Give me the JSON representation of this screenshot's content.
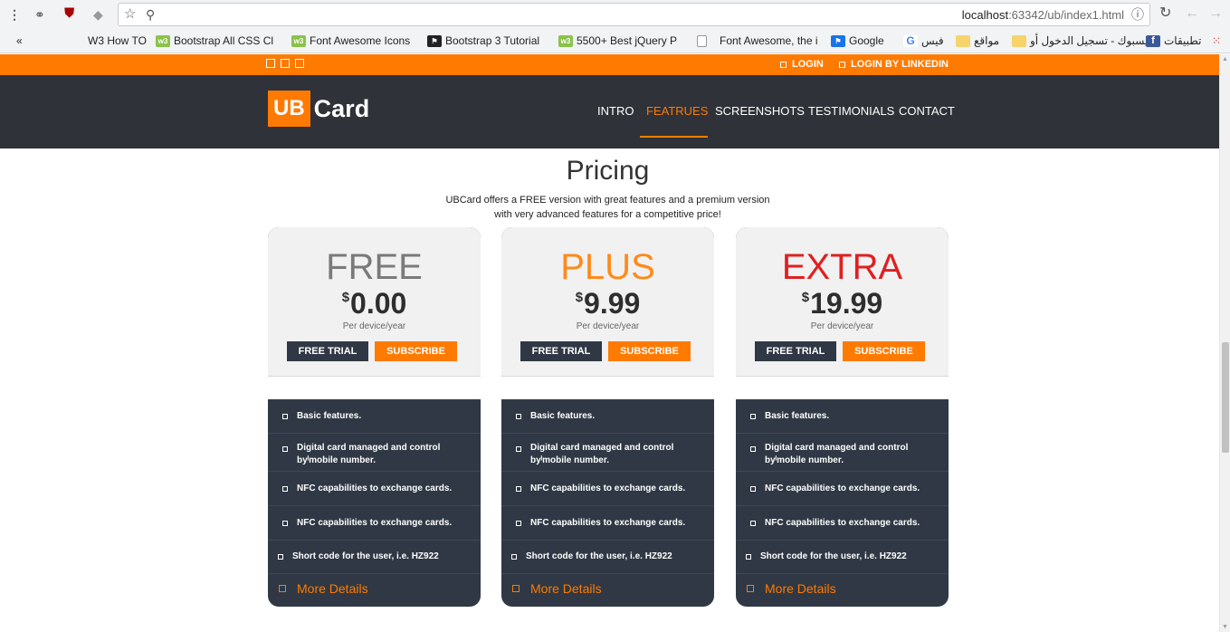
{
  "browser": {
    "url_host": "localhost",
    "url_rest": ":63342/ub/index1.html",
    "bookmarks": [
      {
        "label": "W3 How TO",
        "icon": "none"
      },
      {
        "label": "Bootstrap All CSS Cl",
        "icon": "w3"
      },
      {
        "label": "Font Awesome Icons",
        "icon": "w3"
      },
      {
        "label": "Bootstrap 3 Tutorial",
        "icon": "flag"
      },
      {
        "label": "5500+ Best jQuery P",
        "icon": "w3"
      },
      {
        "label": "Font Awesome, the i",
        "icon": "doc"
      },
      {
        "label": "Google",
        "icon": "blue"
      },
      {
        "label": "فيس",
        "icon": "g"
      },
      {
        "label": "مواقع",
        "icon": "folder"
      },
      {
        "label": "فيسبوك - تسجيل الدخول أو",
        "icon": "folder"
      },
      {
        "label": "تطبيقات",
        "icon": "fb"
      }
    ],
    "overflow_label": "«"
  },
  "topbar": {
    "login": "LOGIN",
    "login_linkedin": "LOGIN BY LINKEDIN"
  },
  "brand": {
    "ub": "UB",
    "card": "Card"
  },
  "nav": {
    "items": [
      "INTRO",
      "FEATRUES",
      "SCREENSHOTS",
      "TESTIMONIALS",
      "CONTACT"
    ],
    "active": "FEATRUES"
  },
  "pricing": {
    "title": "Pricing",
    "subtitle_line1": "UBCard offers a FREE version with great features and a premium version",
    "subtitle_line2": "with very advanced features for a competitive price!",
    "currency": "$",
    "per": "Per device/year",
    "trial_label": "FREE TRIAL",
    "subscribe_label": "SUBSCRIBE",
    "more_label": "More Details",
    "features": [
      "Basic features.",
      "Digital card managed and control byˡmobile number.",
      "NFC capabilities to exchange cards.",
      "NFC capabilities to exchange cards.",
      "Short code for the user, i.e. HZ922"
    ],
    "plans": [
      {
        "name": "FREE",
        "price": "0.00",
        "color": "#7a7a7a"
      },
      {
        "name": "PLUS",
        "price": "9.99",
        "color": "#ff8a1a"
      },
      {
        "name": "EXTRA",
        "price": "19.99",
        "color": "#e02020"
      }
    ]
  },
  "colors": {
    "accent": "#ff7a00",
    "navbar": "#2f3238",
    "card_dark": "#2f3844"
  }
}
